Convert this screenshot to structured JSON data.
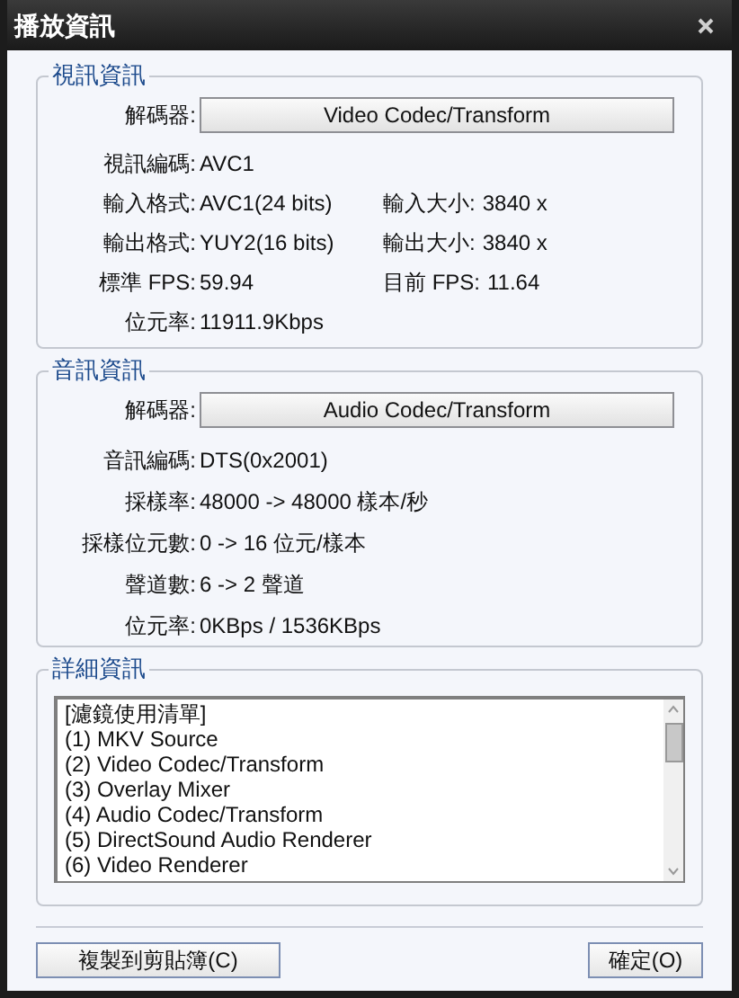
{
  "window": {
    "title": "播放資訊"
  },
  "sections": [
    {
      "legend": "視訊資訊",
      "decoder_label": "解碼器:",
      "decoder_button": "Video Codec/Transform",
      "rows": [
        {
          "label": "視訊編碼:",
          "value": "AVC1"
        },
        {
          "label": "輸入格式:",
          "value": "AVC1(24 bits)",
          "label_2": "輸入大小:",
          "value_2": "3840 x"
        },
        {
          "label": "輸出格式:",
          "value": "YUY2(16 bits)",
          "label_2": "輸出大小:",
          "value_2": "3840 x"
        },
        {
          "label": "標準 FPS:",
          "value": "59.94",
          "label_2": "目前 FPS:",
          "value_2": "11.64"
        },
        {
          "label": "位元率:",
          "value": "11911.9Kbps"
        }
      ]
    },
    {
      "legend": "音訊資訊",
      "decoder_label": "解碼器:",
      "decoder_button": "Audio Codec/Transform",
      "rows": [
        {
          "label": "音訊編碼:",
          "value": "DTS(0x2001)"
        },
        {
          "label": "採樣率:",
          "value": "48000 -> 48000 樣本/秒"
        },
        {
          "label": "採樣位元數:",
          "value": "0 -> 16 位元/樣本"
        },
        {
          "label": "聲道數:",
          "value": "6 -> 2 聲道"
        },
        {
          "label": "位元率:",
          "value": "0KBps / 1536KBps"
        }
      ]
    }
  ],
  "details": {
    "legend": "詳細資訊",
    "lines": [
      "[濾鏡使用清單]",
      "(1) MKV Source",
      "(2) Video Codec/Transform",
      "(3) Overlay Mixer",
      "(4) Audio Codec/Transform",
      "(5) DirectSound Audio Renderer",
      "(6) Video Renderer"
    ]
  },
  "buttons": [
    {
      "label": "複製到剪貼簿(C)"
    },
    {
      "label": "確定(O)"
    }
  ]
}
